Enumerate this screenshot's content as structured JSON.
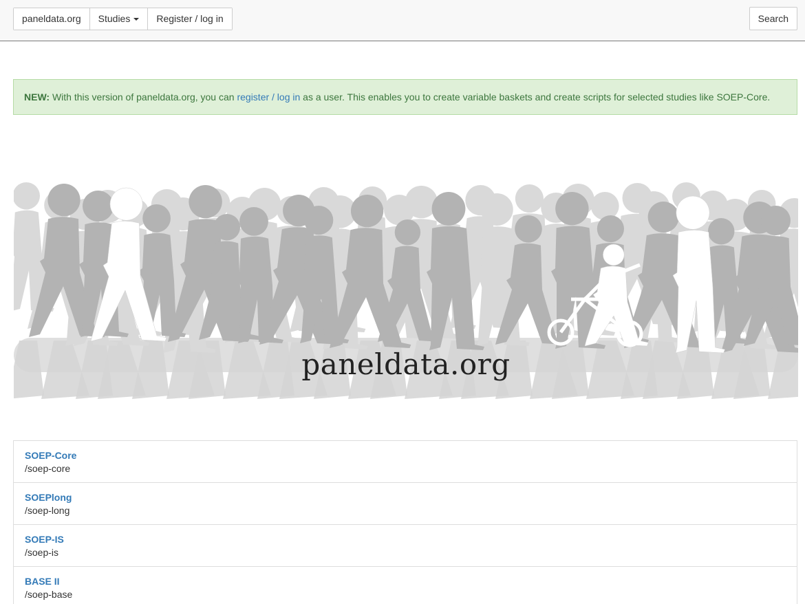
{
  "navbar": {
    "brand": "paneldata.org",
    "studies": "Studies",
    "register": "Register / log in",
    "search": "Search"
  },
  "alert": {
    "prefix": "NEW:",
    "text_before": " With this version of paneldata.org, you can ",
    "link": "register / log in",
    "text_after": " as a user. This enables you to create variable baskets and create scripts for selected studies like SOEP-Core."
  },
  "hero": {
    "title": "paneldata.org"
  },
  "studies": [
    {
      "title": "SOEP-Core",
      "path": "/soep-core"
    },
    {
      "title": "SOEPlong",
      "path": "/soep-long"
    },
    {
      "title": "SOEP-IS",
      "path": "/soep-is"
    },
    {
      "title": "BASE II",
      "path": "/soep-base"
    }
  ]
}
